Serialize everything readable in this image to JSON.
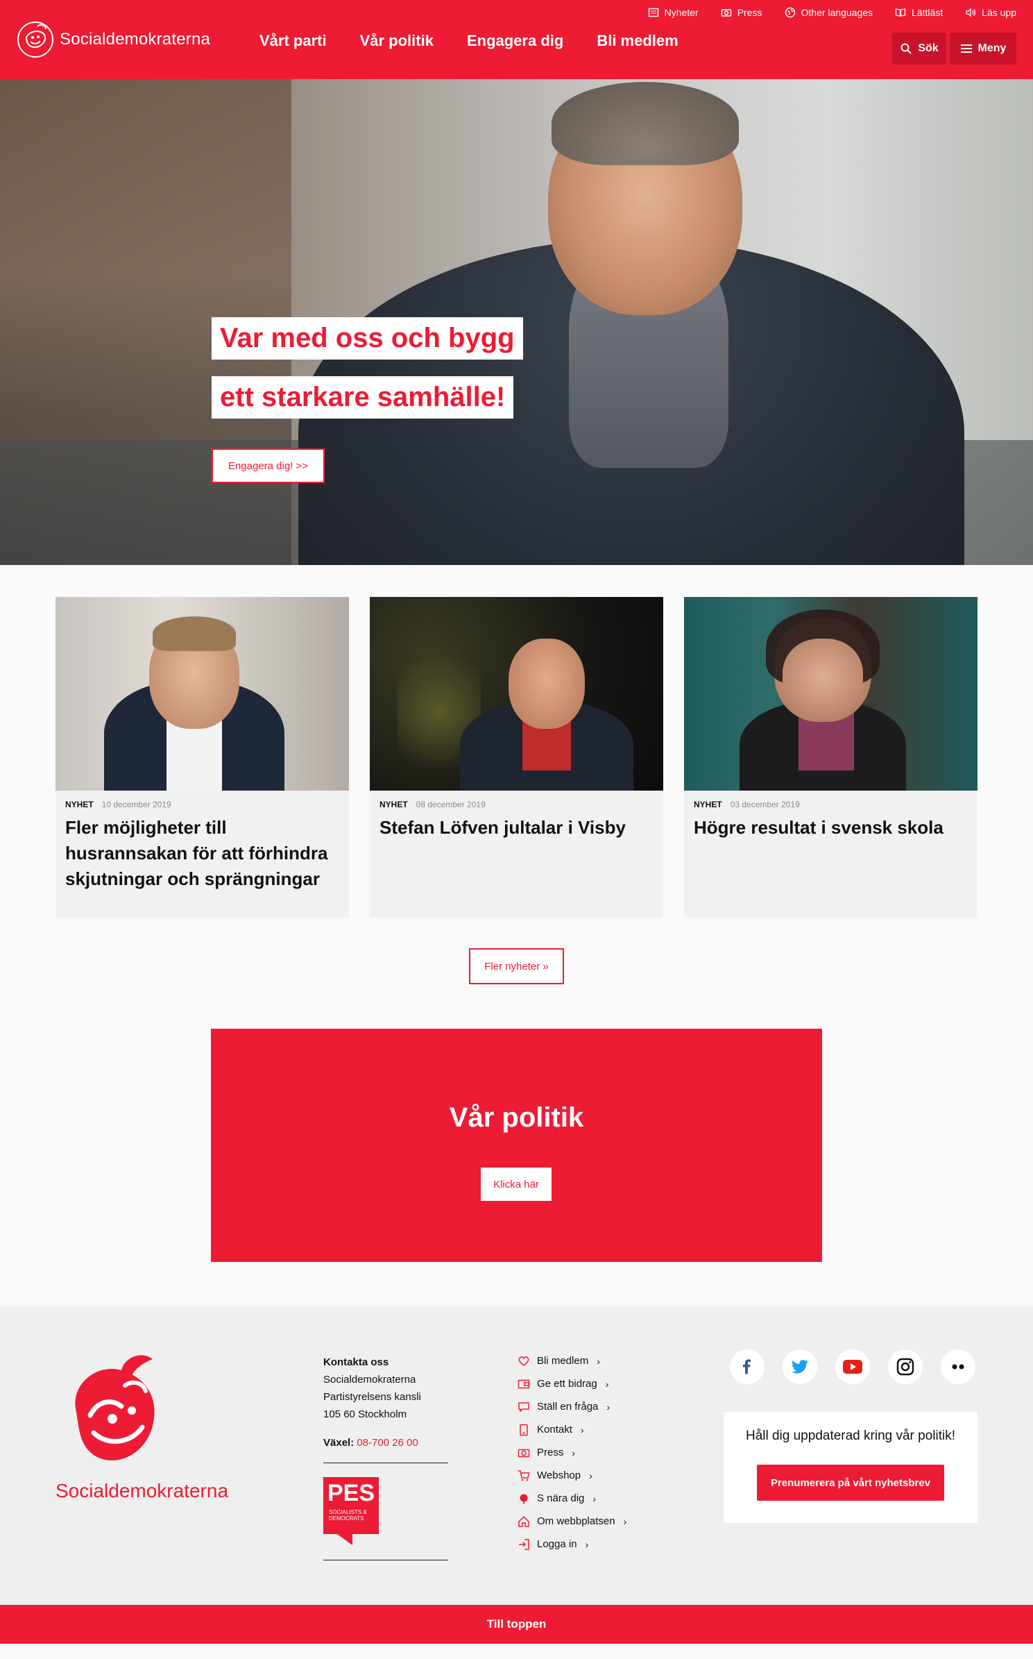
{
  "header": {
    "logo_text": "Socialdemokraterna",
    "topbar": [
      {
        "label": "Nyheter",
        "icon": "newspaper-icon"
      },
      {
        "label": "Press",
        "icon": "camera-icon"
      },
      {
        "label": "Other languages",
        "icon": "globe-icon"
      },
      {
        "label": "Lättläst",
        "icon": "book-icon"
      },
      {
        "label": "Läs upp",
        "icon": "speaker-icon"
      }
    ],
    "nav": [
      "Vårt parti",
      "Vår politik",
      "Engagera dig",
      "Bli medlem"
    ],
    "search_label": "Sök",
    "menu_label": "Meny"
  },
  "hero": {
    "line1": "Var med oss och bygg",
    "line2": "ett starkare samhälle!",
    "cta": "Engagera dig! >>"
  },
  "news": [
    {
      "tag": "NYHET",
      "date": "10 december 2019",
      "title": "Fler möjligheter till husrannsakan för att förhindra skjutningar och sprängningar"
    },
    {
      "tag": "NYHET",
      "date": "08 december 2019",
      "title": "Stefan Löfven jultalar i Visby"
    },
    {
      "tag": "NYHET",
      "date": "03 december 2019",
      "title": "Högre resultat i svensk skola"
    }
  ],
  "more_news": "Fler nyheter »",
  "promo": {
    "title": "Vår politik",
    "button": "Klicka här"
  },
  "footer": {
    "logo_text": "Socialdemokraterna",
    "contact": {
      "heading": "Kontakta oss",
      "line1": "Socialdemokraterna",
      "line2": "Partistyrelsens kansli",
      "line3": "105 60 Stockholm",
      "phone_label": "Växel:",
      "phone": "08-700 26 00"
    },
    "pes": {
      "big": "PES",
      "small1": "SOCIALISTS &",
      "small2": "DEMOCRATS"
    },
    "links": [
      {
        "label": "Bli medlem",
        "icon": "heart-icon"
      },
      {
        "label": "Ge ett bidrag",
        "icon": "wallet-icon"
      },
      {
        "label": "Ställ en fråga",
        "icon": "chat-icon"
      },
      {
        "label": "Kontakt",
        "icon": "phone-icon"
      },
      {
        "label": "Press",
        "icon": "camera-icon"
      },
      {
        "label": "Webshop",
        "icon": "cart-icon"
      },
      {
        "label": "S nära dig",
        "icon": "rose-icon"
      },
      {
        "label": "Om webbplatsen",
        "icon": "home-icon"
      },
      {
        "label": "Logga in",
        "icon": "login-icon"
      }
    ],
    "socials": [
      "facebook-icon",
      "twitter-icon",
      "youtube-icon",
      "instagram-icon",
      "flickr-icon"
    ],
    "newsletter": {
      "text": "Håll dig uppdaterad kring vår politik!",
      "button": "Prenumerera på vårt nyhetsbrev"
    }
  },
  "to_top": "Till toppen",
  "colors": {
    "brand_red": "#ed1b34"
  }
}
